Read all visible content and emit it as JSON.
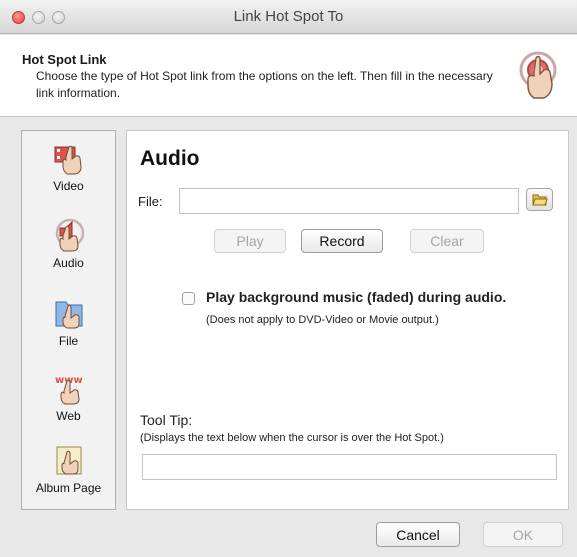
{
  "window": {
    "title": "Link Hot Spot To"
  },
  "header": {
    "title": "Hot Spot Link",
    "description": "Choose the type of Hot Spot link from the options on the left. Then fill in the necessary link information.",
    "icon": "hand-pointer-target-icon"
  },
  "sidebar": {
    "items": [
      {
        "label": "Video",
        "icon": "hand-video-icon"
      },
      {
        "label": "Audio",
        "icon": "hand-audio-icon"
      },
      {
        "label": "File",
        "icon": "hand-file-icon"
      },
      {
        "label": "Web",
        "icon": "hand-web-icon"
      },
      {
        "label": "Album Page",
        "icon": "hand-album-page-icon"
      }
    ],
    "selected": "Audio"
  },
  "main": {
    "section_title": "Audio",
    "file_label": "File:",
    "file_value": "",
    "browse_icon": "folder-open-icon",
    "buttons": {
      "play": "Play",
      "record": "Record",
      "clear": "Clear"
    },
    "background_music": {
      "label": "Play background music (faded) during audio.",
      "note": "(Does not apply to DVD-Video or Movie output.)",
      "checked": false
    },
    "tooltip": {
      "label": "Tool Tip:",
      "note": "(Displays the text below when the cursor is over the Hot Spot.)",
      "value": ""
    }
  },
  "footer": {
    "cancel": "Cancel",
    "ok": "OK"
  },
  "colors": {
    "window_bg": "#e8e8e8",
    "panel_bg": "#ffffff",
    "disabled_text": "#a5a5a5",
    "hand_accent": "#d9534f"
  }
}
